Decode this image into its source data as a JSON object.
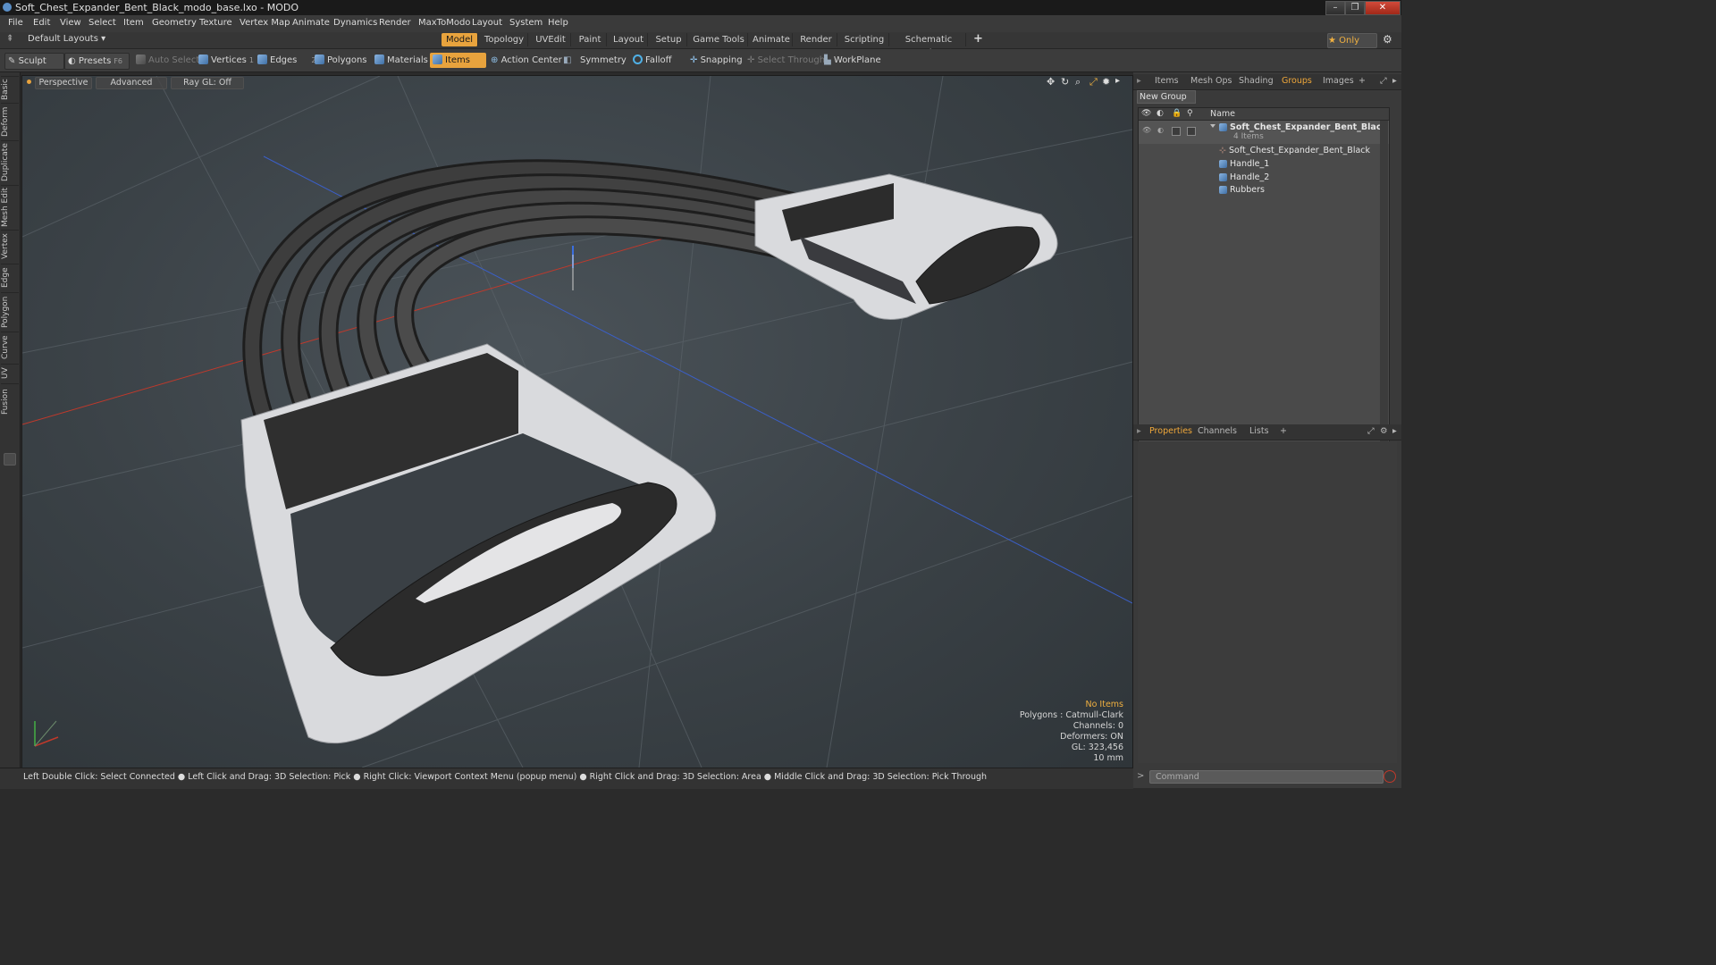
{
  "window": {
    "title": "Soft_Chest_Expander_Bent_Black_modo_base.lxo - MODO",
    "controls": [
      "–",
      "❐",
      "✕"
    ]
  },
  "menu": [
    "File",
    "Edit",
    "View",
    "Select",
    "Item",
    "Geometry",
    "Texture",
    "Vertex Map",
    "Animate",
    "Dynamics",
    "Render",
    "MaxToModo",
    "Layout",
    "System",
    "Help"
  ],
  "layoutbar": {
    "default_layouts": "Default Layouts ▾",
    "tabs": [
      "Model",
      "Topology",
      "UVEdit",
      "Paint",
      "Layout",
      "Setup",
      "Game Tools",
      "Animate",
      "Render",
      "Scripting",
      "Schematic Fusion"
    ],
    "add": "+",
    "only": "★  Only",
    "settings": "⚙"
  },
  "toolbar": {
    "sculpt": "Sculpt",
    "presets": "Presets",
    "presets_key": "F6",
    "auto_select": "Auto Select",
    "vertices": "Vertices",
    "vertices_count": "1",
    "edges": "Edges",
    "edges_count": "2",
    "polygons": "Polygons",
    "materials": "Materials",
    "items": "Items",
    "action_center": "Action Center",
    "symmetry": "Symmetry",
    "falloff": "Falloff",
    "snapping": "Snapping",
    "select_through": "Select Through",
    "workplane": "WorkPlane"
  },
  "left_tabs": [
    "Basic",
    "Deform",
    "Duplicate",
    "Mesh Edit",
    "Vertex",
    "Edge",
    "Polygon",
    "Curve",
    "UV",
    "Fusion"
  ],
  "viewport": {
    "view": "Perspective",
    "advanced": "Advanced",
    "raygl": "Ray GL: Off",
    "info": {
      "no_items": "No Items",
      "polygons": "Polygons : Catmull-Clark",
      "channels": "Channels: 0",
      "deformers": "Deformers: ON",
      "gl": "GL: 323,456",
      "scale": "10 mm"
    }
  },
  "statusbar": "Left Double Click: Select Connected ● Left Click and Drag: 3D Selection: Pick ● Right Click: Viewport Context Menu (popup menu) ● Right Click and Drag: 3D Selection: Area ● Middle Click and Drag: 3D Selection: Pick Through",
  "right_panel": {
    "top_tabs": [
      "Items",
      "Mesh Ops",
      "Shading",
      "Groups",
      "Images",
      "+"
    ],
    "active_top_tab": "Groups",
    "new_group": "New Group",
    "column_name": "Name",
    "group": {
      "name": "Soft_Chest_Expander_Bent_Black",
      "count": "4 Items",
      "children": [
        "Soft_Chest_Expander_Bent_Black",
        "Handle_1",
        "Handle_2",
        "Rubbers"
      ]
    },
    "bottom_tabs": [
      "Properties",
      "Channels",
      "Lists",
      "+"
    ],
    "active_bottom_tab": "Properties",
    "command_placeholder": "Command"
  },
  "colors": {
    "accent": "#e8a33d",
    "panel_bg": "#3a3a3a",
    "viewport_bg": "#3e4549"
  }
}
